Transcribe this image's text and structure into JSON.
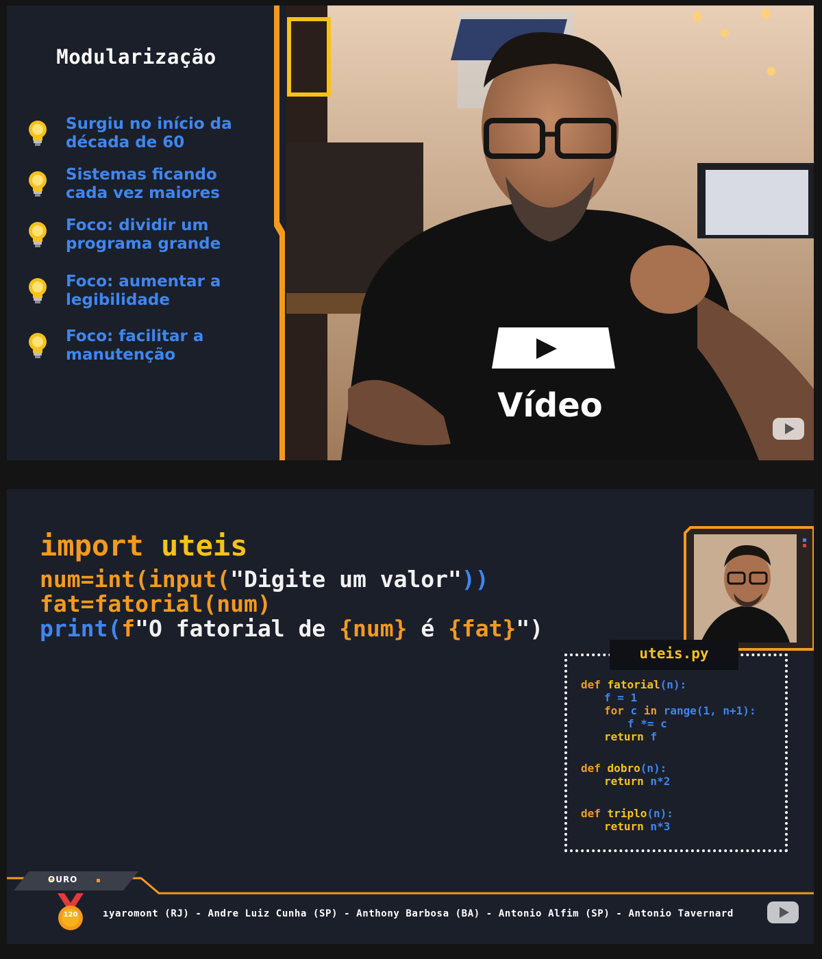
{
  "slide": {
    "title": "Modularização",
    "bullets": [
      "Surgiu no início da\ndécada de 60",
      "Sistemas ficando\ncada vez maiores",
      "Foco: dividir um\nprograma grande",
      "Foco: aumentar a\nlegibilidade",
      "Foco: facilitar a\nmanutenção"
    ]
  },
  "code": {
    "line1": {
      "kw": "import",
      "mod": "uteis"
    },
    "line2": {
      "a": "num=int(input(",
      "b": "\"Digite um valor\"",
      "c": "))"
    },
    "line3": {
      "a": "fat=fatorial(num)"
    },
    "line4": {
      "a": "print(",
      "b": "f",
      "c": "\"O fatorial de ",
      "d": "{num}",
      "e": " é ",
      "f": "{fat}",
      "g": "\")"
    }
  },
  "file": {
    "name": "uteis.py",
    "lines": [
      {
        "kw": "def",
        "name": "fatorial",
        "args": "(n):"
      },
      {
        "text": "f = 1"
      },
      {
        "kw": "for",
        "name": " c ",
        "kw2": "in",
        "args": " range(1, n+1):"
      },
      {
        "text": "f *= c"
      },
      {
        "kw": "return",
        "name": " f"
      },
      {
        "kw": "def",
        "name": "dobro",
        "args": "(n):"
      },
      {
        "kw": "return",
        "name": " n*2"
      },
      {
        "kw": "def",
        "name": "triplo",
        "args": "(n):"
      },
      {
        "kw": "return",
        "name": " n*3"
      }
    ]
  },
  "supporters": {
    "tier": "OURO",
    "medal_number": "120",
    "ticker": "ıyaromont (RJ) - Andre Luiz Cunha (SP) - Anthony Barbosa (BA) - Antonio Alfim (SP) - Antonio Tavernard"
  },
  "icons": {
    "bullet": "lightbulb-icon",
    "watermark": "youtube-play-icon",
    "medal": "medal-icon"
  },
  "colors": {
    "orange": "#f39a1e",
    "yellow": "#f6c21a",
    "blue": "#3f86f0",
    "panel": "#1a1f29",
    "code_bg": "#1b1f2a"
  }
}
